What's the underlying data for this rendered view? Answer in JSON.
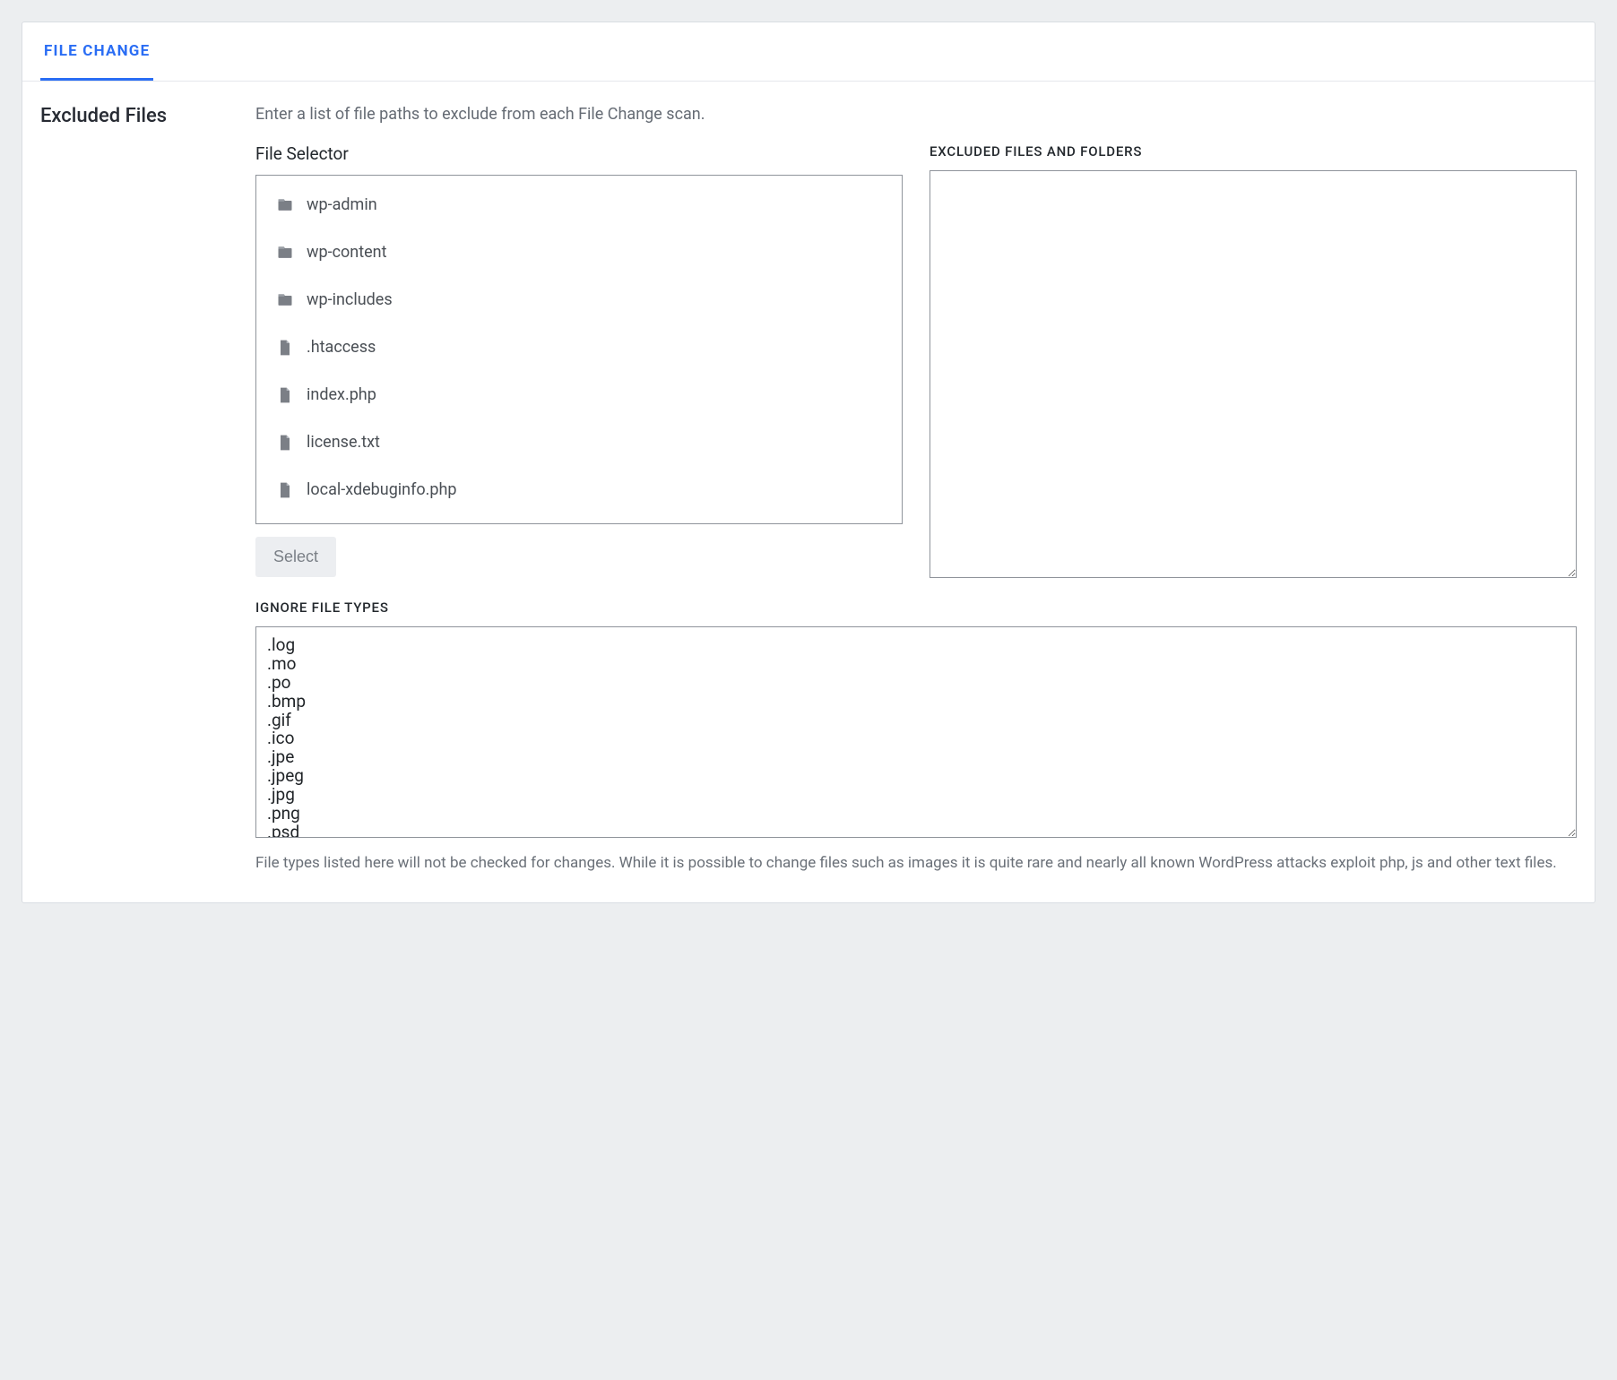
{
  "tab": {
    "label": "FILE CHANGE"
  },
  "section": {
    "title": "Excluded Files",
    "description": "Enter a list of file paths to exclude from each File Change scan."
  },
  "file_selector": {
    "label": "File Selector",
    "items": [
      {
        "type": "folder",
        "name": "wp-admin"
      },
      {
        "type": "folder",
        "name": "wp-content"
      },
      {
        "type": "folder",
        "name": "wp-includes"
      },
      {
        "type": "file",
        "name": ".htaccess"
      },
      {
        "type": "file",
        "name": "index.php"
      },
      {
        "type": "file",
        "name": "license.txt"
      },
      {
        "type": "file",
        "name": "local-xdebuginfo.php"
      }
    ],
    "select_button": "Select"
  },
  "excluded": {
    "label": "EXCLUDED FILES AND FOLDERS",
    "value": ""
  },
  "ignore_types": {
    "label": "IGNORE FILE TYPES",
    "value": ".log\n.mo\n.po\n.bmp\n.gif\n.ico\n.jpe\n.jpeg\n.jpg\n.png\n.psd",
    "help": "File types listed here will not be checked for changes. While it is possible to change files such as images it is quite rare and nearly all known WordPress attacks exploit php, js and other text files."
  },
  "colors": {
    "accent": "#2a6df4"
  }
}
